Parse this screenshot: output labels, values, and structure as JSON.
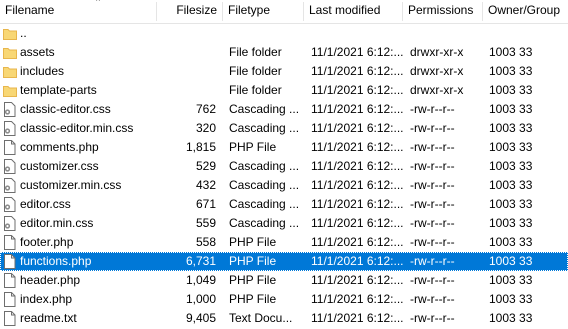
{
  "columns": {
    "filename": "Filename",
    "filesize": "Filesize",
    "filetype": "Filetype",
    "last_modified": "Last modified",
    "permissions": "Permissions",
    "owner_group": "Owner/Group"
  },
  "rows": [
    {
      "icon": "folder-icon",
      "name": "..",
      "size": "",
      "type": "",
      "modified": "",
      "perms": "",
      "owner": ""
    },
    {
      "icon": "folder-icon",
      "name": "assets",
      "size": "",
      "type": "File folder",
      "modified": "11/1/2021 6:12:...",
      "perms": "drwxr-xr-x",
      "owner": "1003 33"
    },
    {
      "icon": "folder-icon",
      "name": "includes",
      "size": "",
      "type": "File folder",
      "modified": "11/1/2021 6:12:...",
      "perms": "drwxr-xr-x",
      "owner": "1003 33"
    },
    {
      "icon": "folder-icon",
      "name": "template-parts",
      "size": "",
      "type": "File folder",
      "modified": "11/1/2021 6:12:...",
      "perms": "drwxr-xr-x",
      "owner": "1003 33"
    },
    {
      "icon": "css-file-icon",
      "name": "classic-editor.css",
      "size": "762",
      "type": "Cascading ...",
      "modified": "11/1/2021 6:12:...",
      "perms": "-rw-r--r--",
      "owner": "1003 33"
    },
    {
      "icon": "css-file-icon",
      "name": "classic-editor.min.css",
      "size": "320",
      "type": "Cascading ...",
      "modified": "11/1/2021 6:12:...",
      "perms": "-rw-r--r--",
      "owner": "1003 33"
    },
    {
      "icon": "file-icon",
      "name": "comments.php",
      "size": "1,815",
      "type": "PHP File",
      "modified": "11/1/2021 6:12:...",
      "perms": "-rw-r--r--",
      "owner": "1003 33"
    },
    {
      "icon": "css-file-icon",
      "name": "customizer.css",
      "size": "529",
      "type": "Cascading ...",
      "modified": "11/1/2021 6:12:...",
      "perms": "-rw-r--r--",
      "owner": "1003 33"
    },
    {
      "icon": "css-file-icon",
      "name": "customizer.min.css",
      "size": "432",
      "type": "Cascading ...",
      "modified": "11/1/2021 6:12:...",
      "perms": "-rw-r--r--",
      "owner": "1003 33"
    },
    {
      "icon": "css-file-icon",
      "name": "editor.css",
      "size": "671",
      "type": "Cascading ...",
      "modified": "11/1/2021 6:12:...",
      "perms": "-rw-r--r--",
      "owner": "1003 33"
    },
    {
      "icon": "css-file-icon",
      "name": "editor.min.css",
      "size": "559",
      "type": "Cascading ...",
      "modified": "11/1/2021 6:12:...",
      "perms": "-rw-r--r--",
      "owner": "1003 33"
    },
    {
      "icon": "file-icon",
      "name": "footer.php",
      "size": "558",
      "type": "PHP File",
      "modified": "11/1/2021 6:12:...",
      "perms": "-rw-r--r--",
      "owner": "1003 33"
    },
    {
      "icon": "file-icon",
      "name": "functions.php",
      "size": "6,731",
      "type": "PHP File",
      "modified": "11/1/2021 6:12:...",
      "perms": "-rw-r--r--",
      "owner": "1003 33",
      "selected": true
    },
    {
      "icon": "file-icon",
      "name": "header.php",
      "size": "1,049",
      "type": "PHP File",
      "modified": "11/1/2021 6:12:...",
      "perms": "-rw-r--r--",
      "owner": "1003 33"
    },
    {
      "icon": "file-icon",
      "name": "index.php",
      "size": "1,000",
      "type": "PHP File",
      "modified": "11/1/2021 6:12:...",
      "perms": "-rw-r--r--",
      "owner": "1003 33"
    },
    {
      "icon": "file-icon",
      "name": "readme.txt",
      "size": "9,405",
      "type": "Text Docu...",
      "modified": "11/1/2021 6:12:...",
      "perms": "-rw-r--r--",
      "owner": "1003 33"
    }
  ],
  "colors": {
    "selection": "#0078d7",
    "folder": "#f8d775",
    "folder_dark": "#e8b64c",
    "file_border": "#6e6e6e"
  }
}
